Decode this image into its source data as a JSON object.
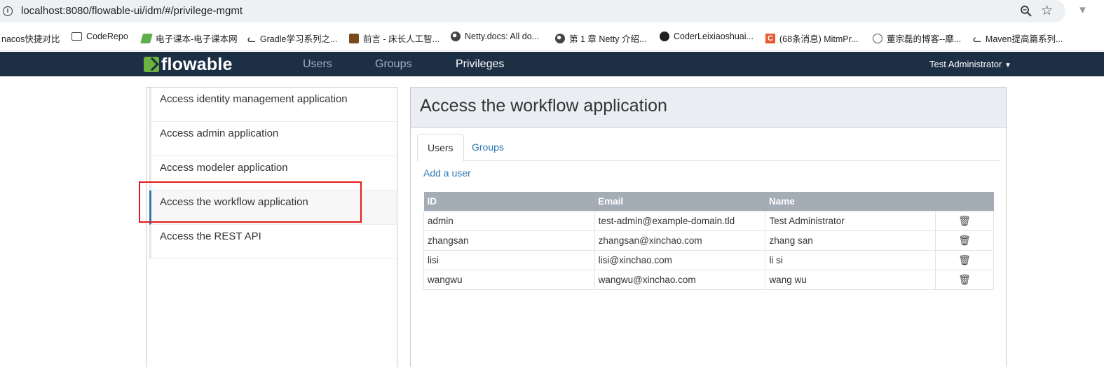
{
  "browser": {
    "url": "localhost:8080/flowable-ui/idm/#/privilege-mgmt",
    "bookmarks": [
      {
        "label": "nacos快捷对比",
        "icon": "none"
      },
      {
        "label": "CodeRepo",
        "icon": "folder-icon"
      },
      {
        "label": "电子课本-电子课本网",
        "icon": "site-icon"
      },
      {
        "label": "Gradle学习系列之...",
        "icon": "gradle-icon"
      },
      {
        "label": "前言 - 床长人工智...",
        "icon": "book-icon"
      },
      {
        "label": "Netty.docs: All do...",
        "icon": "netty-icon"
      },
      {
        "label": "第 1 章 Netty 介绍...",
        "icon": "netty-icon"
      },
      {
        "label": "CoderLeixiaoshuai...",
        "icon": "github-icon"
      },
      {
        "label": "(68条消息) MitmPr...",
        "icon": "csdn-icon"
      },
      {
        "label": "董宗磊的博客--靡...",
        "icon": "globe-icon"
      },
      {
        "label": "Maven提高篇系列...",
        "icon": "gradle-icon"
      }
    ]
  },
  "nav": {
    "logo": "flowable",
    "items": [
      {
        "label": "Users"
      },
      {
        "label": "Groups"
      },
      {
        "label": "Privileges"
      }
    ],
    "active": "Privileges",
    "user": "Test Administrator"
  },
  "privileges": {
    "items": [
      {
        "label": "Access identity management application"
      },
      {
        "label": "Access admin application"
      },
      {
        "label": "Access modeler application"
      },
      {
        "label": "Access the workflow application"
      },
      {
        "label": "Access the REST API"
      }
    ],
    "selected": "Access the workflow application"
  },
  "detail": {
    "title": "Access the workflow application",
    "tabs": [
      {
        "label": "Users"
      },
      {
        "label": "Groups"
      }
    ],
    "active_tab": "Users",
    "add_link": "Add a user",
    "table": {
      "headers": [
        "ID",
        "Email",
        "Name"
      ],
      "rows": [
        {
          "id": "admin",
          "email": "test-admin@example-domain.tld",
          "name": "Test Administrator"
        },
        {
          "id": "zhangsan",
          "email": "zhangsan@xinchao.com",
          "name": "zhang san"
        },
        {
          "id": "lisi",
          "email": "lisi@xinchao.com",
          "name": "li si"
        },
        {
          "id": "wangwu",
          "email": "wangwu@xinchao.com",
          "name": "wang wu"
        }
      ]
    }
  },
  "colors": {
    "navbar": "#1d2f44",
    "accent": "#2a7ab5",
    "logo_green": "#6cb33f",
    "highlight": "#e41a1a"
  }
}
